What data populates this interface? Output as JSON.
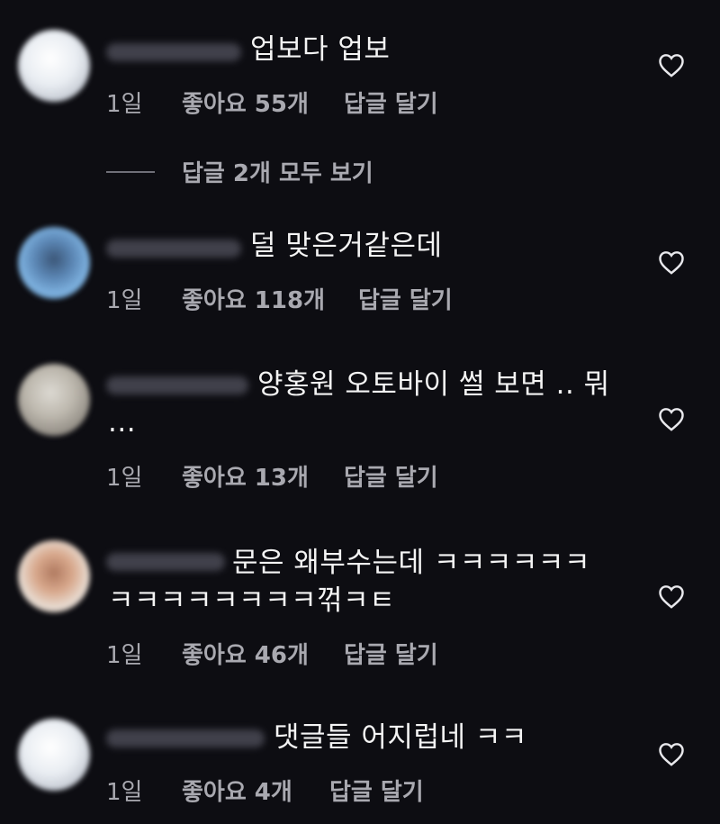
{
  "comments": [
    {
      "text": "업보다 업보",
      "time": "1일",
      "likes": "좋아요 55개",
      "reply": "답글 달기"
    },
    {
      "text": "덜 맞은거같은데",
      "time": "1일",
      "likes": "좋아요 118개",
      "reply": "답글 달기"
    },
    {
      "text": "양홍원 오토바이 썰 보면 .. 뭐\n...",
      "time": "1일",
      "likes": "좋아요 13개",
      "reply": "답글 달기"
    },
    {
      "text": "문은 왜부수는데 ㅋㅋㅋㅋㅋㅋ\nㅋㅋㅋㅋㅋㅋㅋㅋ꺾ㅋㅌ",
      "time": "1일",
      "likes": "좋아요 46개",
      "reply": "답글 달기"
    },
    {
      "text": "댓글들 어지럽네 ㅋㅋ",
      "time": "1일",
      "likes": "좋아요 4개",
      "reply": "답글 달기"
    }
  ],
  "view_replies": "답글 2개 모두 보기",
  "icons": {
    "like": "heart-outline-icon"
  },
  "colors": {
    "background": "#0d0d12",
    "text": "#f4f4f4",
    "meta": "#a9a9b0"
  }
}
